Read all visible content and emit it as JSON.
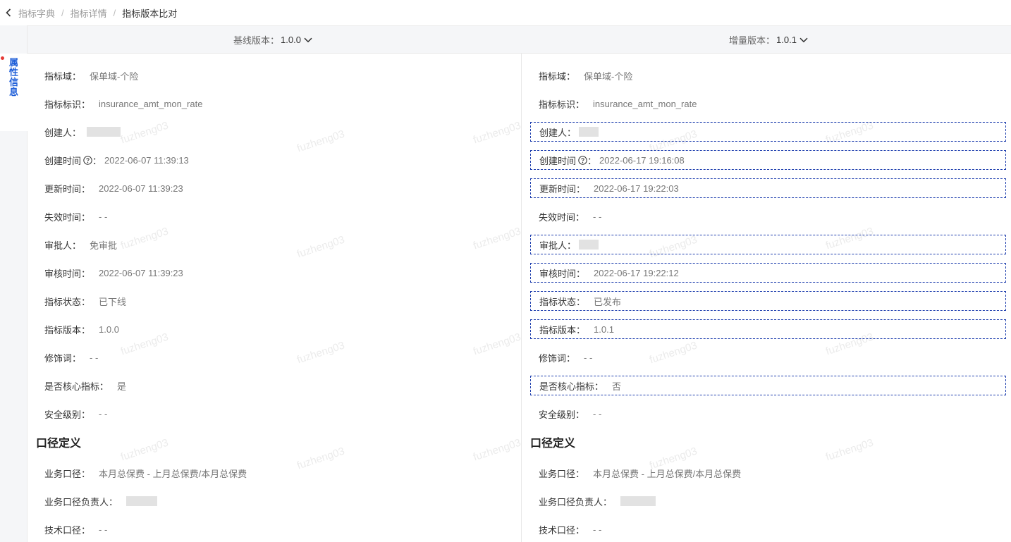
{
  "breadcrumb": {
    "items": [
      "指标字典",
      "指标详情",
      "指标版本比对"
    ],
    "separator": "/"
  },
  "sidebar": {
    "tab_label": "属性信息",
    "tab_chars": [
      "属",
      "性",
      "信",
      "息"
    ]
  },
  "header": {
    "baseline_label": "基线版本：",
    "baseline_value": "1.0.0",
    "increment_label": "增量版本：",
    "increment_value": "1.0.1"
  },
  "watermark": "fuzheng03",
  "left": {
    "attrs": [
      {
        "key": "指标域：",
        "value": "保单域-个险"
      },
      {
        "key": "指标标识：",
        "value": "insurance_amt_mon_rate"
      },
      {
        "key": "创建人：",
        "value": ""
      },
      {
        "key": "创建时间",
        "value": "2022-06-07 11:39:13"
      },
      {
        "key": "更新时间：",
        "value": "2022-06-07 11:39:23"
      },
      {
        "key": "失效时间：",
        "value": "- -"
      },
      {
        "key": "审批人：",
        "value": "免审批"
      },
      {
        "key": "审核时间：",
        "value": "2022-06-07 11:39:23"
      },
      {
        "key": "指标状态：",
        "value": "已下线"
      },
      {
        "key": "指标版本：",
        "value": "1.0.0"
      },
      {
        "key": "修饰词：",
        "value": "- -"
      },
      {
        "key": "是否核心指标：",
        "value": "是"
      },
      {
        "key": "安全级别：",
        "value": "- -"
      }
    ],
    "section_title": "口径定义",
    "caliber": [
      {
        "key": "业务口径：",
        "value": "本月总保费 - 上月总保费/本月总保费"
      },
      {
        "key": "业务口径负责人：",
        "value": ""
      },
      {
        "key": "技术口径：",
        "value": "- -"
      }
    ]
  },
  "right": {
    "attrs": [
      {
        "key": "指标域：",
        "value": "保单域-个险"
      },
      {
        "key": "指标标识：",
        "value": "insurance_amt_mon_rate"
      },
      {
        "key": "创建人：",
        "value": ""
      },
      {
        "key": "创建时间",
        "value": "2022-06-17 19:16:08"
      },
      {
        "key": "更新时间：",
        "value": "2022-06-17 19:22:03"
      },
      {
        "key": "失效时间：",
        "value": "- -"
      },
      {
        "key": "审批人：",
        "value": ""
      },
      {
        "key": "审核时间：",
        "value": "2022-06-17 19:22:12"
      },
      {
        "key": "指标状态：",
        "value": "已发布"
      },
      {
        "key": "指标版本：",
        "value": "1.0.1"
      },
      {
        "key": "修饰词：",
        "value": "- -"
      },
      {
        "key": "是否核心指标：",
        "value": "否"
      },
      {
        "key": "安全级别：",
        "value": "- -"
      }
    ],
    "section_title": "口径定义",
    "caliber": [
      {
        "key": "业务口径：",
        "value": "本月总保费 - 上月总保费/本月总保费"
      },
      {
        "key": "业务口径负责人：",
        "value": ""
      },
      {
        "key": "技术口径：",
        "value": "- -"
      }
    ]
  },
  "colors": {
    "accent": "#1e5ed8",
    "diff_border": "#1f3fae",
    "dot": "#e53935"
  },
  "icons": {
    "back": "chevron-left-icon",
    "dropdown": "chevron-down-icon",
    "help": "question-circle-icon"
  }
}
